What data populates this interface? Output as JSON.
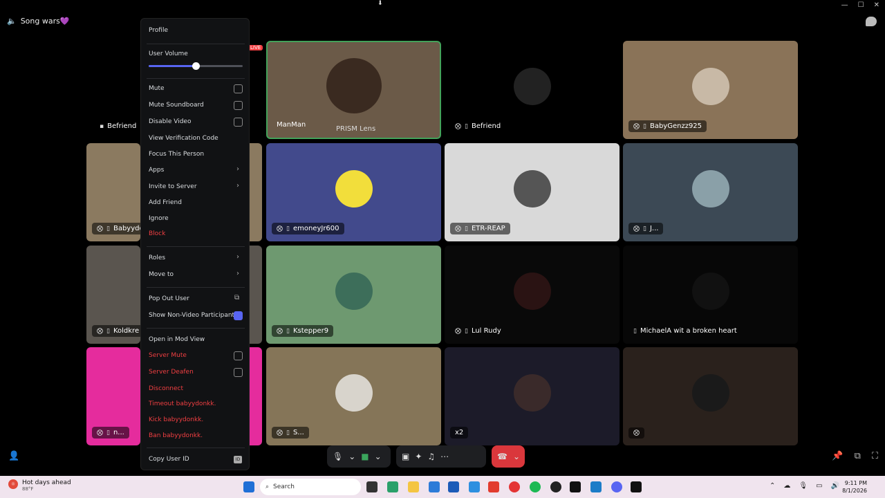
{
  "channel": {
    "name": "Song wars💜"
  },
  "live_badge": "LIVE",
  "tiles": [
    {
      "name": "ManMan",
      "extra": "PRISM Lens",
      "bg": "#6b5a48"
    },
    {
      "name": "Befriend",
      "bg": "#000000"
    },
    {
      "name": "BabyGenzz925",
      "bg": "#8a7358"
    },
    {
      "name": "emoneyJr600",
      "bg": "#424a8c"
    },
    {
      "name": "ETR-REAP",
      "bg": "#d9d9d9"
    },
    {
      "name": "J...",
      "bg": "#3c4955"
    },
    {
      "name": "Kstepper9",
      "bg": "#6e9970"
    },
    {
      "name": "Lul Rudy",
      "bg": "#090909"
    },
    {
      "name": "MichaelA wit a broken heart",
      "bg": "#070707"
    },
    {
      "name": "S...",
      "bg": "#857558"
    },
    {
      "name": "x2",
      "bg": "#1c1b29"
    },
    {
      "name": "",
      "bg": "#2a211c"
    },
    {
      "name": "Befriend",
      "bg": "#000000"
    },
    {
      "name": "Babyydo",
      "bg": "#8b7a60"
    },
    {
      "name": "Koldkre",
      "bg": "#5a554f"
    },
    {
      "name": "n...",
      "bg": "#e52c9d"
    }
  ],
  "menu": {
    "profile": "Profile",
    "user_volume": "User Volume",
    "volume_level": 0.5,
    "mute": "Mute",
    "mute_soundboard": "Mute Soundboard",
    "disable_video": "Disable Video",
    "view_verification": "View Verification Code",
    "focus_person": "Focus This Person",
    "apps": "Apps",
    "invite": "Invite to Server",
    "add_friend": "Add Friend",
    "ignore": "Ignore",
    "block": "Block",
    "roles": "Roles",
    "move_to": "Move to",
    "pop_out": "Pop Out User",
    "show_non_video": "Show Non-Video Participants",
    "open_mod": "Open in Mod View",
    "server_mute": "Server Mute",
    "server_deafen": "Server Deafen",
    "disconnect": "Disconnect",
    "timeout": "Timeout babyydonkk.",
    "kick": "Kick babyydonkk.",
    "ban": "Ban babyydonkk.",
    "copy_id": "Copy User ID",
    "id_badge": "ID"
  },
  "taskbar": {
    "weather_title": "Hot days ahead",
    "weather_temp": "88°F",
    "search_placeholder": "Search",
    "time": "9:11 PM",
    "date": "8/1/2026"
  }
}
